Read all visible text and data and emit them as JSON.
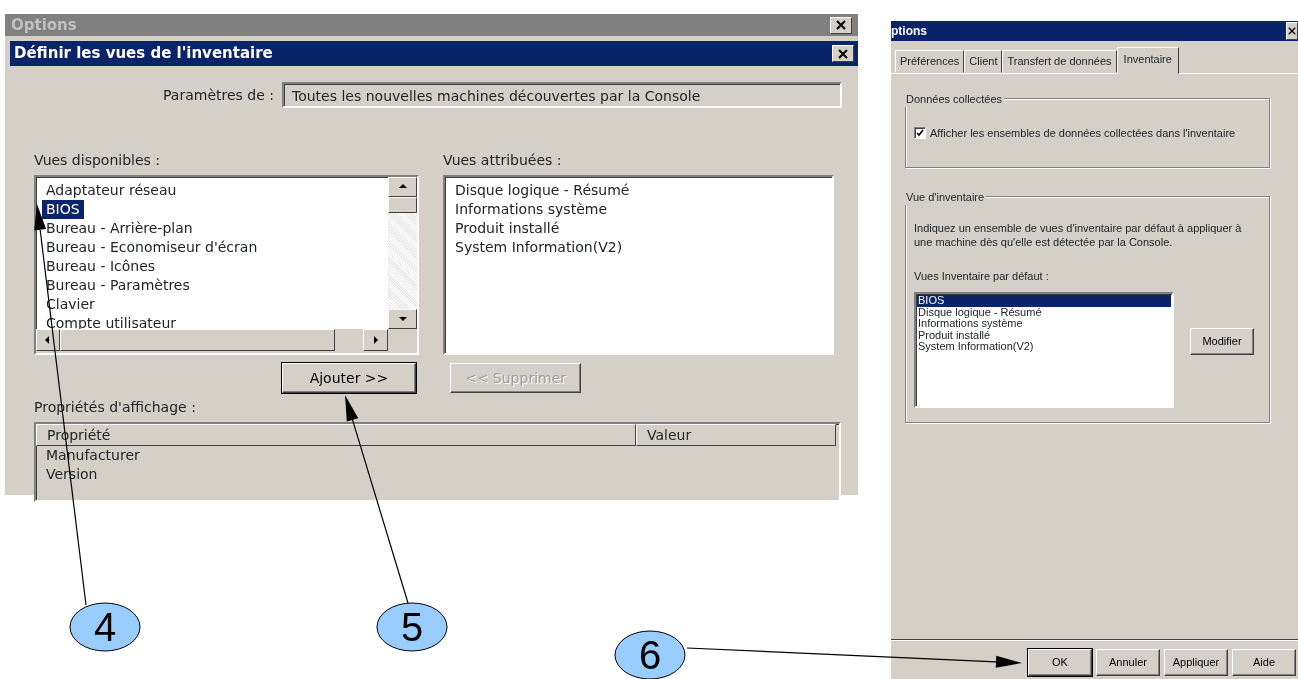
{
  "left_window": {
    "outer_title": "Options",
    "title": "Définir les vues de l'inventaire",
    "settings_label": "Paramètres de :",
    "settings_value": "Toutes les nouvelles machines découvertes par la Console",
    "available": {
      "label": "Vues disponibles :",
      "items": [
        {
          "text": "Adaptateur réseau",
          "selected": false
        },
        {
          "text": "BIOS",
          "selected": true
        },
        {
          "text": "Bureau - Arrière-plan",
          "selected": false
        },
        {
          "text": "Bureau - Economiseur d'écran",
          "selected": false
        },
        {
          "text": "Bureau - Icônes",
          "selected": false
        },
        {
          "text": "Bureau - Paramètres",
          "selected": false
        },
        {
          "text": "Clavier",
          "selected": false
        },
        {
          "text": "Compte utilisateur",
          "selected": false
        }
      ]
    },
    "assigned": {
      "label": "Vues attribuées :",
      "items": [
        {
          "text": "Disque logique - Résumé",
          "selected": false
        },
        {
          "text": "Informations système",
          "selected": false
        },
        {
          "text": "Produit installé",
          "selected": false
        },
        {
          "text": "System Information(V2)",
          "selected": false
        }
      ]
    },
    "buttons": [
      {
        "label": "Ajouter >>",
        "disabled": false
      },
      {
        "label": "<< Supprimer",
        "disabled": true
      }
    ],
    "properties": {
      "label": "Propriétés d'affichage :",
      "columns": [
        "Propriété",
        "Valeur"
      ],
      "rows": [
        "Manufacturer",
        "Version"
      ]
    }
  },
  "right_window": {
    "title": "ptions",
    "tabs": [
      {
        "label": "Préférences",
        "selected": false
      },
      {
        "label": "Client",
        "selected": false
      },
      {
        "label": "Transfert de données",
        "selected": false
      },
      {
        "label": "Inventaire",
        "selected": true
      }
    ],
    "collected": {
      "legend": "Données collectées",
      "checkbox": {
        "label": "Afficher les ensembles de données collectées dans l'inventaire",
        "checked": true
      }
    },
    "view": {
      "legend": "Vue d'inventaire",
      "description": "Indiquez un ensemble de vues d'inventaire par défaut à appliquer à une machine dès qu'elle est détectée par la Console.",
      "list_label": "Vues Inventaire par défaut :",
      "items": [
        {
          "text": "BIOS",
          "selected": true
        },
        {
          "text": "Disque logique - Résumé",
          "selected": false
        },
        {
          "text": "Informations système",
          "selected": false
        },
        {
          "text": "Produit installé",
          "selected": false
        },
        {
          "text": "System Information(V2)",
          "selected": false
        }
      ],
      "modify_button": "Modifier"
    },
    "buttons": [
      "OK",
      "Annuler",
      "Appliquer",
      "Aide"
    ]
  },
  "annotations": [
    {
      "label": "4"
    },
    {
      "label": "5"
    },
    {
      "label": "6"
    }
  ]
}
